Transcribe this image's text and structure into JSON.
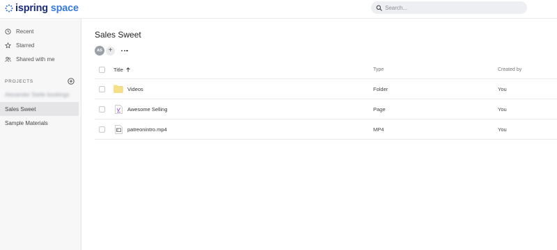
{
  "app": {
    "logo_part1": "ispring",
    "logo_part2": "space",
    "accent": "#1c2c7a",
    "accent_light": "#3a7bd8"
  },
  "search": {
    "placeholder": "Search..."
  },
  "sidebar": {
    "nav": [
      {
        "label": "Recent",
        "icon": "clock-icon"
      },
      {
        "label": "Starred",
        "icon": "star-icon"
      },
      {
        "label": "Shared with me",
        "icon": "people-icon"
      }
    ],
    "projects_heading": "PROJECTS",
    "projects": [
      {
        "label": "Alexander Stelle bookings",
        "blurred": true
      },
      {
        "label": "Sales Sweet",
        "selected": true
      },
      {
        "label": "Sample Materials"
      }
    ]
  },
  "main": {
    "title": "Sales Sweet",
    "owner_initials": "AS",
    "add_member_label": "+",
    "columns": {
      "title": "Title",
      "type": "Type",
      "created_by": "Created by"
    },
    "rows": [
      {
        "title": "Videos",
        "type": "Folder",
        "created_by": "You",
        "icon": "folder-icon"
      },
      {
        "title": "Awesome Selling",
        "type": "Page",
        "created_by": "You",
        "icon": "page-icon"
      },
      {
        "title": "patreonintro.mp4",
        "type": "MP4",
        "created_by": "You",
        "icon": "video-file-icon"
      }
    ]
  }
}
